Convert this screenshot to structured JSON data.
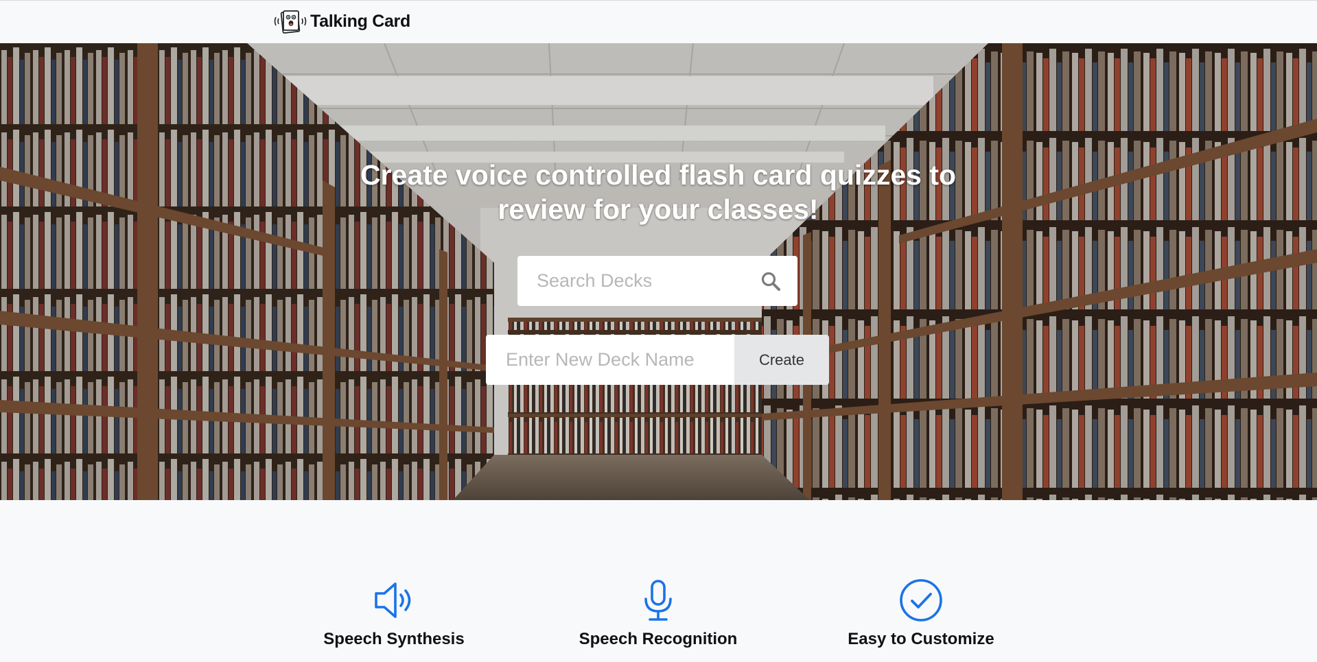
{
  "navbar": {
    "brand_name": "Talking Card",
    "logo_icon": "talking-card-logo-icon"
  },
  "hero": {
    "title": "Create voice controlled flash card quizzes to review for your classes!",
    "background": "library-bookshelves-photo",
    "search": {
      "placeholder": "Search Decks",
      "value": "",
      "icon": "search-icon"
    },
    "create": {
      "placeholder": "Enter New Deck Name",
      "value": "",
      "button_label": "Create"
    }
  },
  "features": [
    {
      "title": "Speech Synthesis",
      "icon": "speaker-icon"
    },
    {
      "title": "Speech Recognition",
      "icon": "microphone-icon"
    },
    {
      "title": "Easy to Customize",
      "icon": "check-circle-icon"
    }
  ],
  "colors": {
    "accent": "#1a73e8",
    "navbar_bg": "#f8f9fa",
    "button_bg": "#e4e6e8",
    "hero_text": "#ffffff"
  }
}
